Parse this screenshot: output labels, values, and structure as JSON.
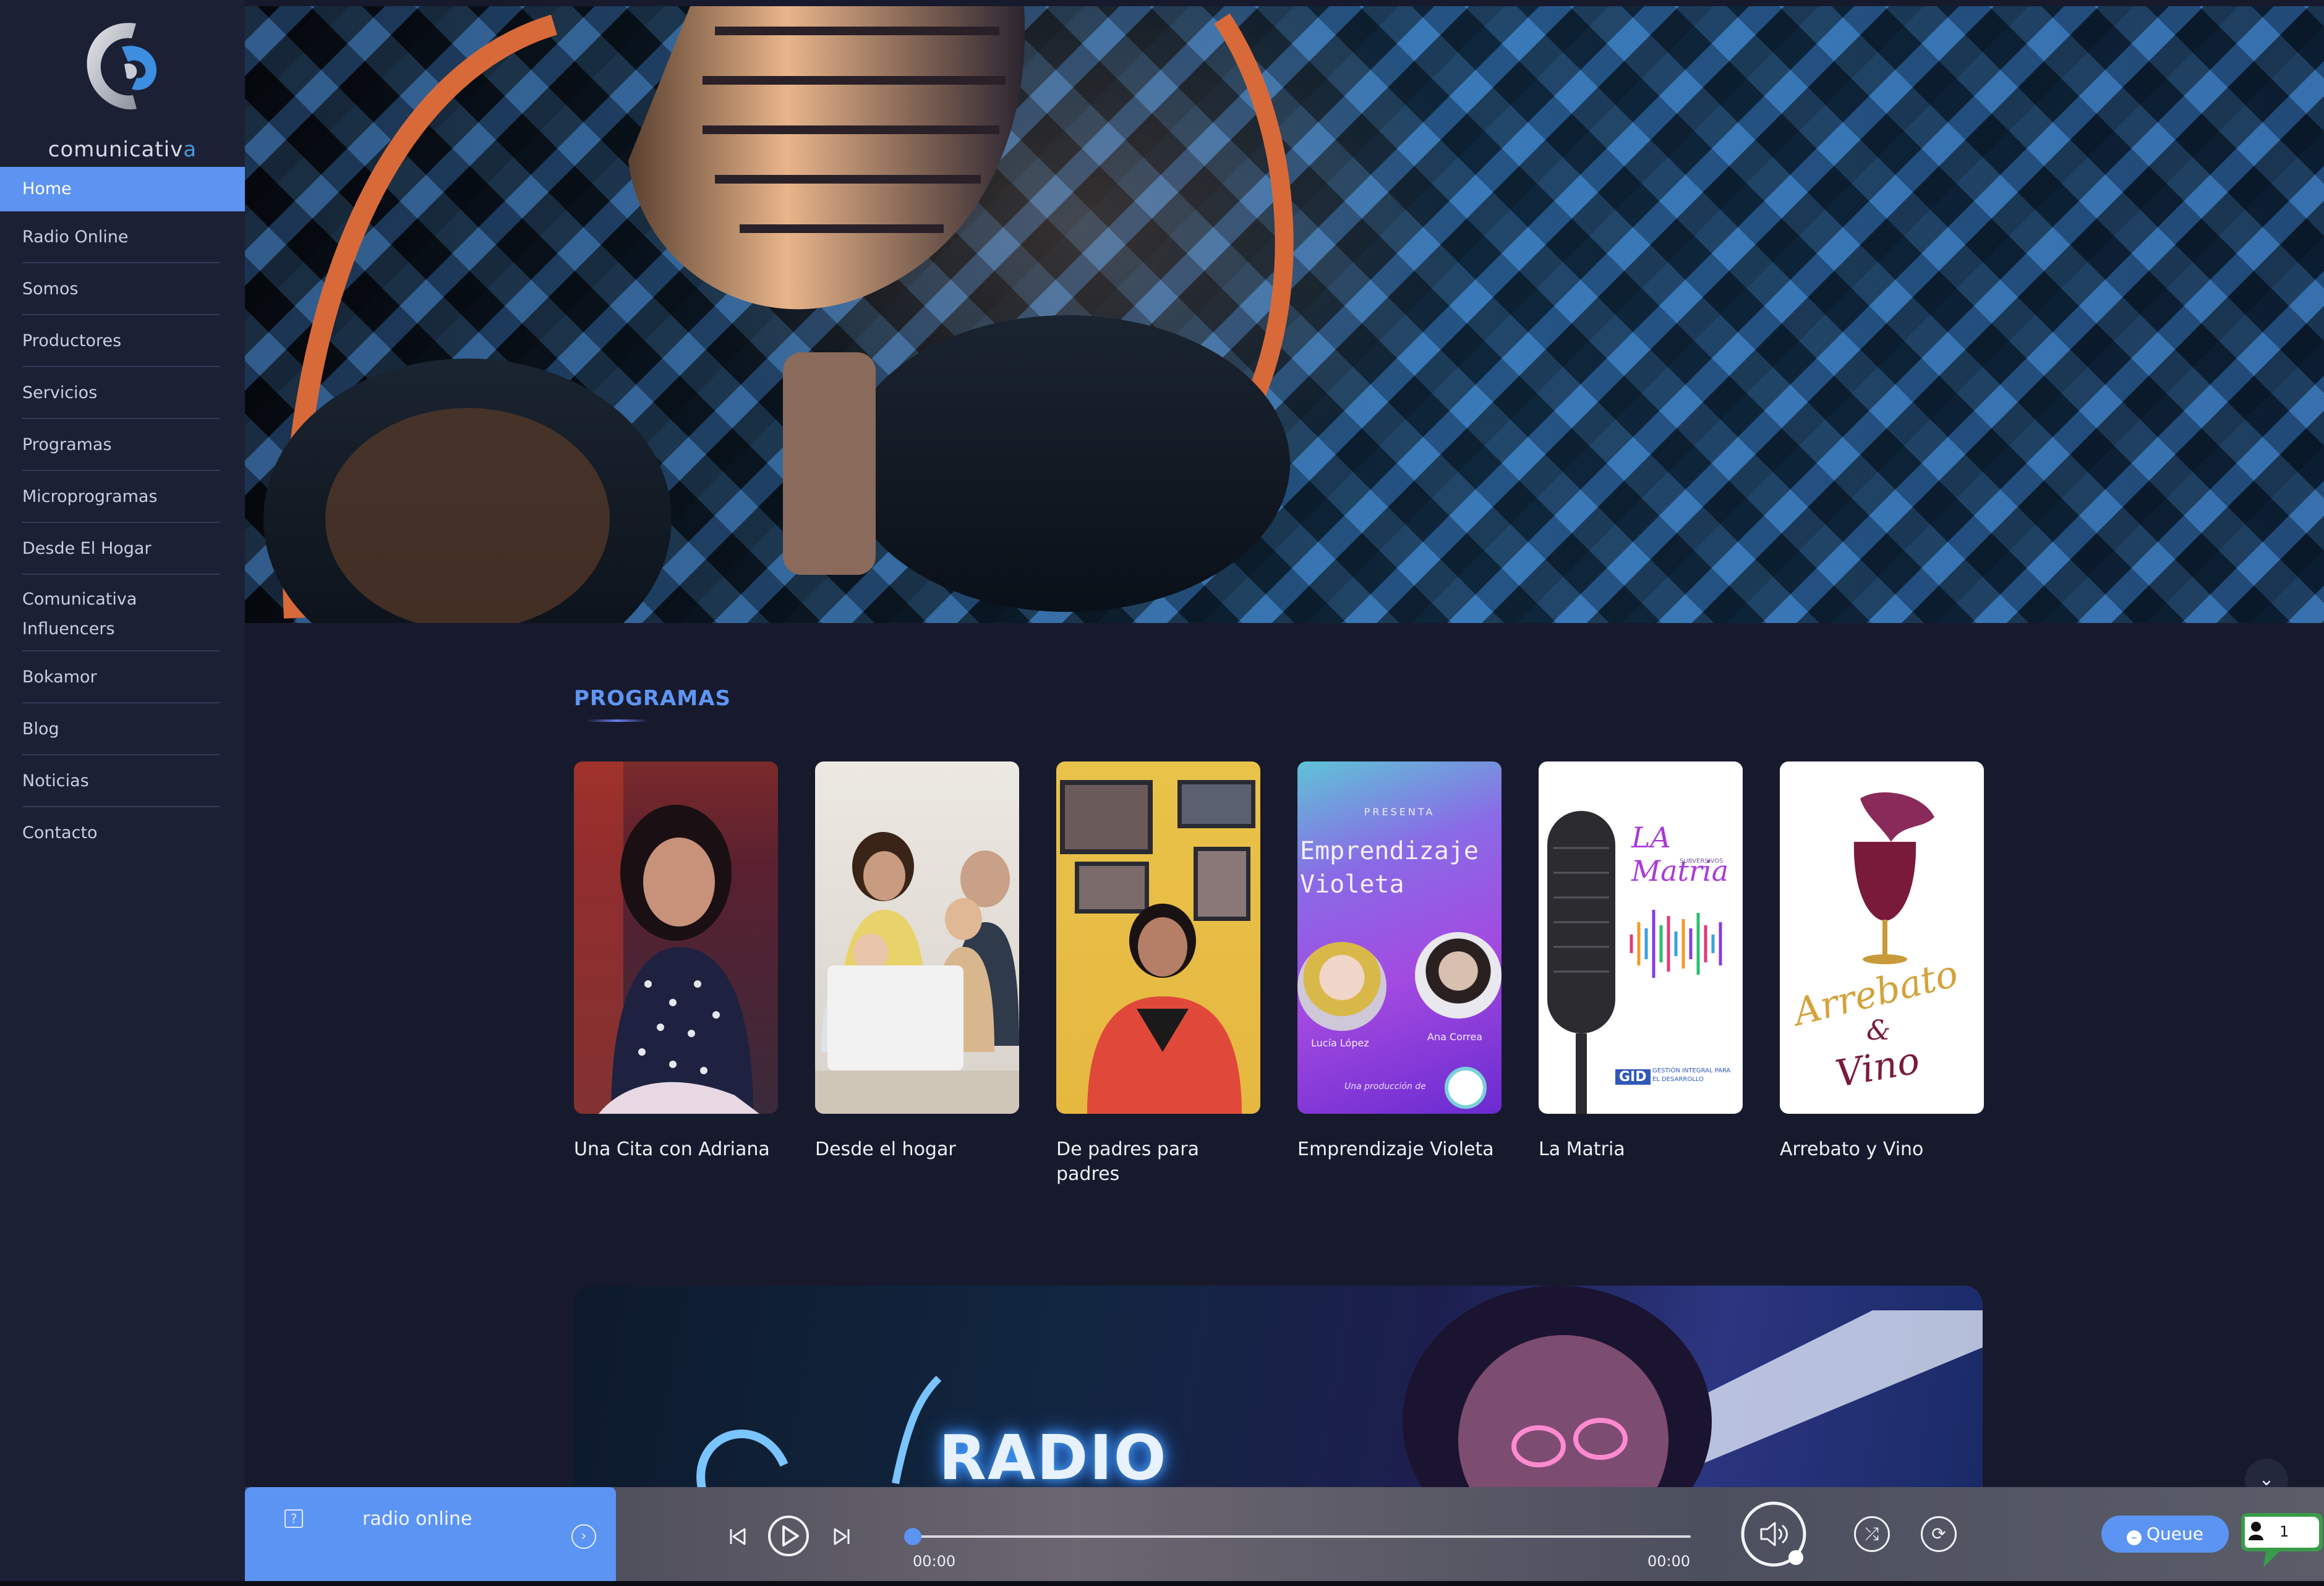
{
  "brand": {
    "logo_text_main": "comunicativ",
    "logo_text_accent": "a"
  },
  "sidebar": {
    "items": [
      {
        "label": "Home",
        "active": true
      },
      {
        "label": "Radio Online"
      },
      {
        "label": "Somos"
      },
      {
        "label": "Productores"
      },
      {
        "label": "Servicios"
      },
      {
        "label": "Programas"
      },
      {
        "label": "Microprogramas"
      },
      {
        "label": "Desde El Hogar"
      },
      {
        "label": "Comunicativa Influencers"
      },
      {
        "label": "Bokamor"
      },
      {
        "label": "Blog"
      },
      {
        "label": "Noticias"
      },
      {
        "label": "Contacto"
      }
    ]
  },
  "programas": {
    "title": "PROGRAMAS",
    "cards": [
      {
        "title": "Una Cita con Adriana"
      },
      {
        "title": "Desde el hogar"
      },
      {
        "title": "De padres para padres"
      },
      {
        "title": "Emprendizaje Violeta",
        "poster": {
          "presenta": "PRESENTA",
          "line1": "Emprendizaje",
          "line2": "Violeta",
          "host1": "Lucía López",
          "host2": "Ana Correa",
          "footer": "Una producción de"
        }
      },
      {
        "title": "La Matria",
        "poster": {
          "brand": "LA Matria",
          "sub": "SUBVERSIVOS",
          "org": "GID",
          "org_sub": "GESTIÓN INTEGRAL PARA EL DESARROLLO"
        }
      },
      {
        "title": "Arrebato y Vino",
        "poster": {
          "line1": "Arrebato",
          "amp": "&",
          "line2": "Vino"
        }
      }
    ]
  },
  "banner": {
    "text": "RADIO"
  },
  "player": {
    "track_title": "radio online",
    "time_current": "00:00",
    "time_total": "00:00",
    "progress": 0,
    "queue_label": "Queue",
    "chat_count": "1"
  },
  "colors": {
    "accent": "#5d93f1",
    "sidebar_bg": "#1c2035",
    "page_bg": "#171a2c"
  }
}
